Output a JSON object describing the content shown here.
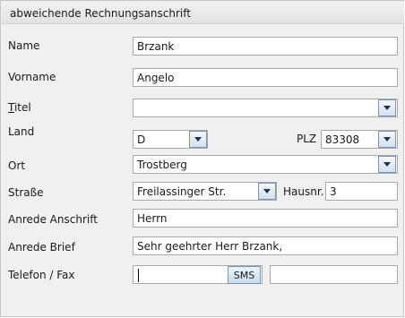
{
  "panel": {
    "title": "abweichende Rechnungsanschrift"
  },
  "fields": {
    "name": {
      "label": "Name",
      "value": "Brzank"
    },
    "vorname": {
      "label": "Vorname",
      "value": "Angelo"
    },
    "titel": {
      "label_first": "T",
      "label_rest": "itel",
      "value": ""
    },
    "land": {
      "label": "Land",
      "value": "D"
    },
    "plz": {
      "label": "PLZ",
      "value": "83308"
    },
    "ort": {
      "label": "Ort",
      "value": "Trostberg"
    },
    "strasse": {
      "label": "Straße",
      "value": "Freilassinger Str."
    },
    "hausnr": {
      "label": "Hausnr.",
      "value": "3"
    },
    "anrede_anschrift": {
      "label": "Anrede Anschrift",
      "value": "Herrn"
    },
    "anrede_brief": {
      "label": "Anrede Brief",
      "value": "Sehr geehrter Herr Brzank,"
    },
    "telefon_fax": {
      "label": "Telefon / Fax",
      "telefon_value": "",
      "fax_value": "",
      "sms_label": "SMS"
    }
  },
  "icons": {
    "dropdown": "chevron-down-icon"
  },
  "colors": {
    "header_bg": "#e6e6e6",
    "panel_bg": "#f0f0f0",
    "field_border": "#a9a9a9",
    "dropdown_arrow": "#1d2e57"
  }
}
